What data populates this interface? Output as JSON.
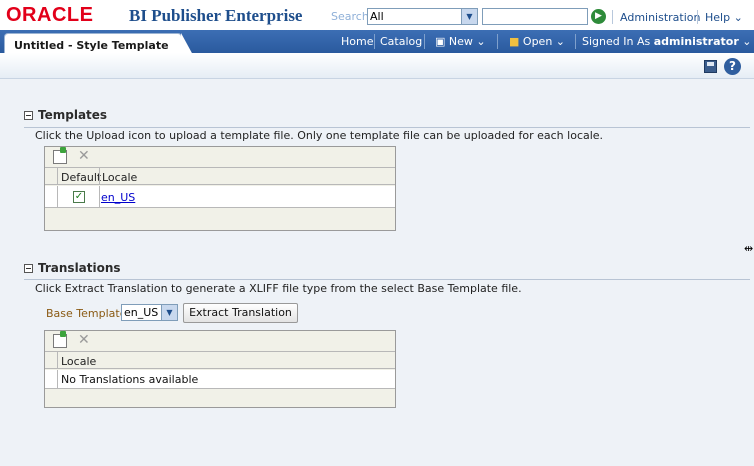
{
  "header": {
    "logo": "ORACLE",
    "product": "BI Publisher Enterprise",
    "search_label": "Search",
    "search_scope": "All",
    "search_value": "",
    "links": {
      "administration": "Administration",
      "help": "Help"
    }
  },
  "navbar": {
    "tab_title": "Untitled - Style Template",
    "home": "Home",
    "catalog": "Catalog",
    "new": "New",
    "open": "Open",
    "signed_in_as": "Signed In As",
    "user": "administrator"
  },
  "templates": {
    "title": "Templates",
    "description": "Click the Upload icon to upload a template file. Only one template file can be uploaded for each locale.",
    "columns": [
      "Default",
      "Locale"
    ],
    "rows": [
      {
        "default": true,
        "locale": "en_US"
      }
    ]
  },
  "translations": {
    "title": "Translations",
    "description": "Click Extract Translation to generate a XLIFF file type from the select Base Template file.",
    "base_template_label": "Base Template",
    "base_template_value": "en_US",
    "extract_button": "Extract Translation",
    "columns": [
      "Locale"
    ],
    "empty_message": "No Translations available"
  },
  "colors": {
    "oracle_red": "#e2001a",
    "product_blue": "#1e4e8c",
    "navbar_blue": "#2a5a9e",
    "link_blue": "#0000cc"
  }
}
